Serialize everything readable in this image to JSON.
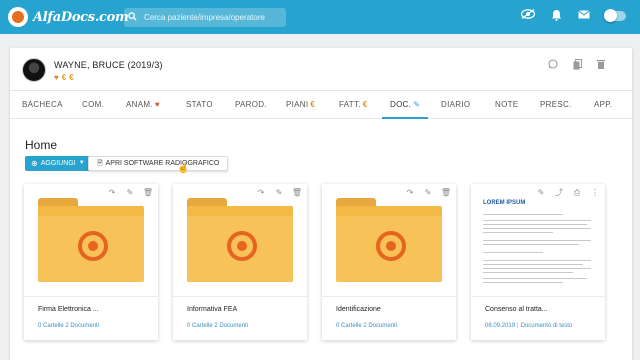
{
  "app": {
    "logo_text": "AlfaDocs.com"
  },
  "search": {
    "placeholder": "Cerca paziente/impresa/operatore"
  },
  "topbar_icons": [
    "eye-icon",
    "bell-icon",
    "mail-icon",
    "toggle"
  ],
  "patient": {
    "name": "WAYNE, BRUCE (2019/3)",
    "badges": [
      "heart-icon",
      "euro-icon",
      "euro-icon"
    ]
  },
  "patient_actions": [
    "whatsapp-icon",
    "copy-icon",
    "trash-icon"
  ],
  "tabs": [
    {
      "label": "BACHECA",
      "suffix": ""
    },
    {
      "label": "COM.",
      "suffix": ""
    },
    {
      "label": "ANAM.",
      "suffix": "♥"
    },
    {
      "label": "STATO",
      "suffix": ""
    },
    {
      "label": "PAROD.",
      "suffix": ""
    },
    {
      "label": "PIANI",
      "suffix": "€"
    },
    {
      "label": "FATT.",
      "suffix": "€"
    },
    {
      "label": "DOC.",
      "suffix": "✎"
    },
    {
      "label": "DIARIO",
      "suffix": ""
    },
    {
      "label": "NOTE",
      "suffix": ""
    },
    {
      "label": "PRESC.",
      "suffix": ""
    },
    {
      "label": "APP.",
      "suffix": ""
    }
  ],
  "active_tab": "DOC.",
  "home": {
    "title": "Home",
    "add_button": "AGGIUNGI",
    "radio_button": "APRI SOFTWARE RADIOGRAFICO"
  },
  "documents": [
    {
      "title": "Firma Elettronica ...",
      "meta": "0 Cartelle 2 Documenti",
      "type": "folder"
    },
    {
      "title": "Informativa FEA",
      "meta": "0 Cartelle 2 Documenti",
      "type": "folder"
    },
    {
      "title": "Identificazione",
      "meta": "0 Cartelle 2 Documenti",
      "type": "folder"
    },
    {
      "title": "Consenso al tratta...",
      "date": "08.09.2019",
      "meta": "Documento di testo",
      "type": "document",
      "preview_logo": "LOREM IPSUM"
    }
  ],
  "colors": {
    "primary": "#27a3cf",
    "folder": "#f4b945",
    "accent": "#e5641f"
  }
}
